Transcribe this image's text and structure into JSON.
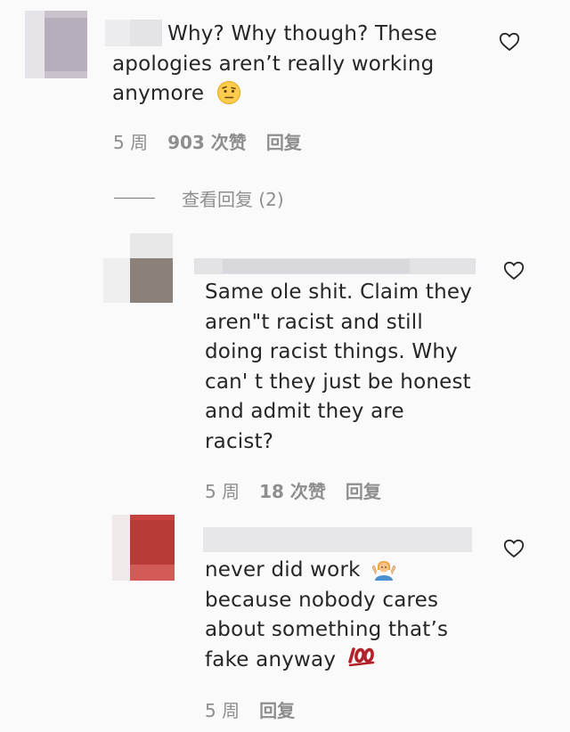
{
  "comments": [
    {
      "text_line1": "Why? Why though? These",
      "text_line2": "apologies aren’t really working",
      "text_line3": "anymore",
      "emoji_icon": "face-with-raised-eyebrow-emoji",
      "meta": {
        "time": "5 周",
        "likes": "903 次赞",
        "reply": "回复"
      }
    }
  ],
  "view_replies": {
    "label": "查看回复 (2)"
  },
  "replies": [
    {
      "lines": [
        "Same ole shit. Claim they",
        "aren\"t racist and still",
        "doing racist things. Why",
        "can' t they just be honest",
        "and admit they are",
        "racist?"
      ],
      "meta": {
        "time": "5 周",
        "likes": "18 次赞",
        "reply": "回复"
      }
    },
    {
      "line1": "never did work",
      "line1_emoji": "person-shrugging-emoji",
      "line2": "because nobody cares",
      "line3": "about something that’s",
      "line4": "fake anyway",
      "line4_emoji": "hundred-points-emoji",
      "meta": {
        "time": "5 周",
        "reply": "回复"
      }
    }
  ],
  "colors": {
    "background": "#fafafa",
    "text": "#262626",
    "meta": "#8e8e8e",
    "hundred_emoji": "#b3222c",
    "shrug_hair": "#e8a23a",
    "shrug_shirt": "#4a8fd1"
  }
}
